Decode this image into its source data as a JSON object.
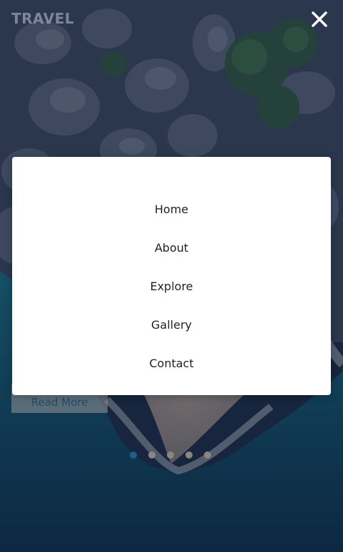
{
  "header": {
    "brand": "TRAVEL",
    "close_icon": "close-icon"
  },
  "menu": {
    "items": [
      {
        "label": "Home"
      },
      {
        "label": "About"
      },
      {
        "label": "Explore"
      },
      {
        "label": "Gallery"
      },
      {
        "label": "Contact"
      }
    ]
  },
  "hero": {
    "read_more_label": "Read More"
  },
  "carousel": {
    "total_slides": 5,
    "active_index": 0,
    "active_color": "#1d5f8f",
    "inactive_color": "#8b8680"
  }
}
